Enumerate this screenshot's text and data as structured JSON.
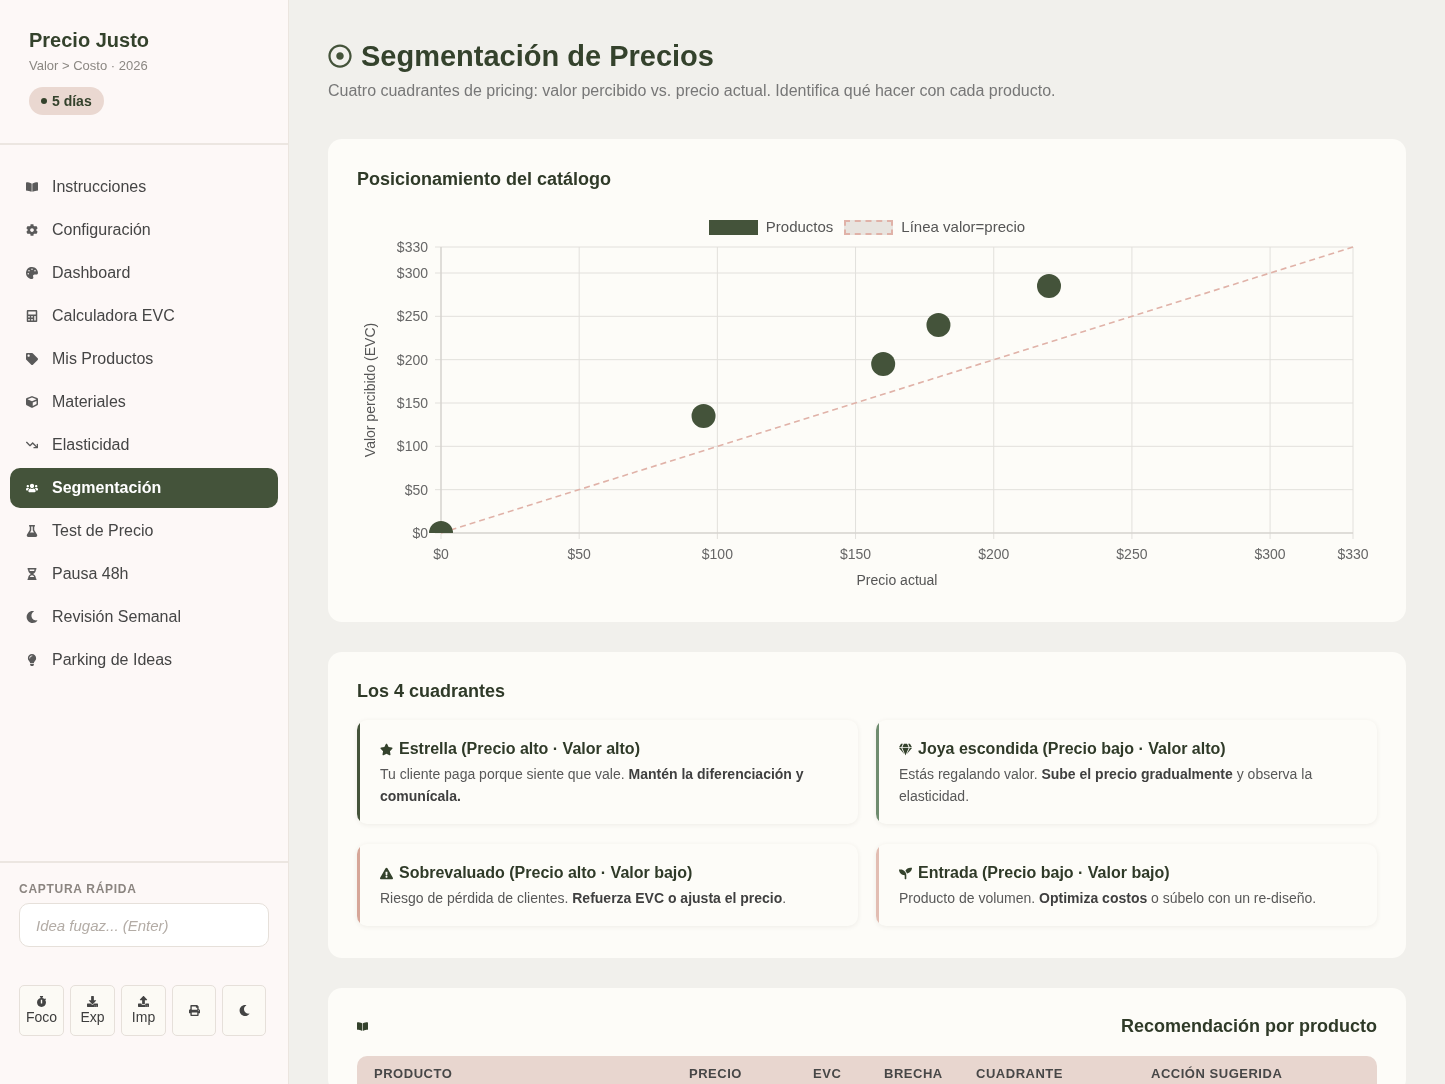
{
  "sidebar": {
    "app_title": "Precio Justo",
    "subtitle": "Valor > Costo · 2026",
    "badge": "5 días",
    "nav": [
      {
        "label": "Instrucciones",
        "selected": false
      },
      {
        "label": "Configuración",
        "selected": false
      },
      {
        "label": "Dashboard",
        "selected": false
      },
      {
        "label": "Calculadora EVC",
        "selected": false
      },
      {
        "label": "Mis Productos",
        "selected": false
      },
      {
        "label": "Materiales",
        "selected": false
      },
      {
        "label": "Elasticidad",
        "selected": false
      },
      {
        "label": "Segmentación",
        "selected": true
      },
      {
        "label": "Test de Precio",
        "selected": false
      },
      {
        "label": "Pausa 48h",
        "selected": false
      },
      {
        "label": "Revisión Semanal",
        "selected": false
      },
      {
        "label": "Parking de Ideas",
        "selected": false
      }
    ],
    "quick_capture": {
      "label": "CAPTURA RÁPIDA",
      "placeholder": "Idea fugaz... (Enter)"
    },
    "actions": [
      {
        "kind": "labeled",
        "label": "Foco"
      },
      {
        "kind": "labeled",
        "label": "Exp"
      },
      {
        "kind": "labeled",
        "label": "Imp"
      },
      {
        "kind": "icon"
      },
      {
        "kind": "icon"
      }
    ]
  },
  "page": {
    "title": "Segmentación de Precios",
    "subtitle": "Cuatro cuadrantes de pricing: valor percibido vs. precio actual. Identifica qué hacer con cada producto."
  },
  "positioning": {
    "chart_data": {
      "type": "scatter",
      "title": "Posicionamiento del catálogo",
      "xlabel": "Precio actual",
      "ylabel": "Valor percibido (EVC)",
      "x": [
        0,
        95,
        160,
        180,
        220
      ],
      "series": [
        {
          "name": "Productos",
          "color": "#44533a",
          "values": [
            0,
            135,
            195,
            240,
            285
          ]
        },
        {
          "name": "Línea valor=precio",
          "type": "line",
          "line_style": "dashed",
          "color": "#e0b2a8",
          "x": [
            0,
            330
          ],
          "values": [
            0,
            330
          ]
        }
      ],
      "legend": "top",
      "grid": true,
      "xlim": [
        0,
        330
      ],
      "ylim": [
        0,
        330
      ],
      "xticks": [
        {
          "value": 0,
          "label": "$0"
        },
        {
          "value": 50,
          "label": "$50"
        },
        {
          "value": 100,
          "label": "$100"
        },
        {
          "value": 150,
          "label": "$150"
        },
        {
          "value": 200,
          "label": "$200"
        },
        {
          "value": 250,
          "label": "$250"
        },
        {
          "value": 300,
          "label": "$300"
        },
        {
          "value": 330,
          "label": "$330"
        }
      ],
      "yticks": [
        {
          "value": 0,
          "label": "$0"
        },
        {
          "value": 50,
          "label": "$50"
        },
        {
          "value": 100,
          "label": "$100"
        },
        {
          "value": 150,
          "label": "$150"
        },
        {
          "value": 200,
          "label": "$200"
        },
        {
          "value": 250,
          "label": "$250"
        },
        {
          "value": 300,
          "label": "$300"
        },
        {
          "value": 330,
          "label": "$330"
        }
      ]
    }
  },
  "quadrants": {
    "title": "Los 4 cuadrantes",
    "items": [
      {
        "title": "Estrella (Precio alto · Valor alto)",
        "text": "Tu cliente paga porque siente que vale. **Mantén la diferenciación y comunícala.**",
        "color": "#44533a"
      },
      {
        "title": "Joya escondida (Precio bajo · Valor alto)",
        "text": "Estás regalando valor. **Sube el precio gradualmente** y observa la elasticidad.",
        "color": "#6f8c6f"
      },
      {
        "title": "Sobrevaluado (Precio alto · Valor bajo)",
        "text": "Riesgo de pérdida de clientes. **Refuerza EVC o ajusta el precio**.",
        "color": "#d6a698"
      },
      {
        "title": "Entrada (Precio bajo · Valor bajo)",
        "text": "Producto de volumen. **Optimiza costos** o súbelo con un re-diseño.",
        "color": "#e2bdb2"
      }
    ]
  },
  "recommendations": {
    "title": "Recomendación por producto",
    "table": {
      "columns": [
        "PRODUCTO",
        "PRECIO",
        "EVC",
        "BRECHA",
        "CUADRANTE",
        "ACCIÓN SUGERIDA"
      ]
    }
  }
}
